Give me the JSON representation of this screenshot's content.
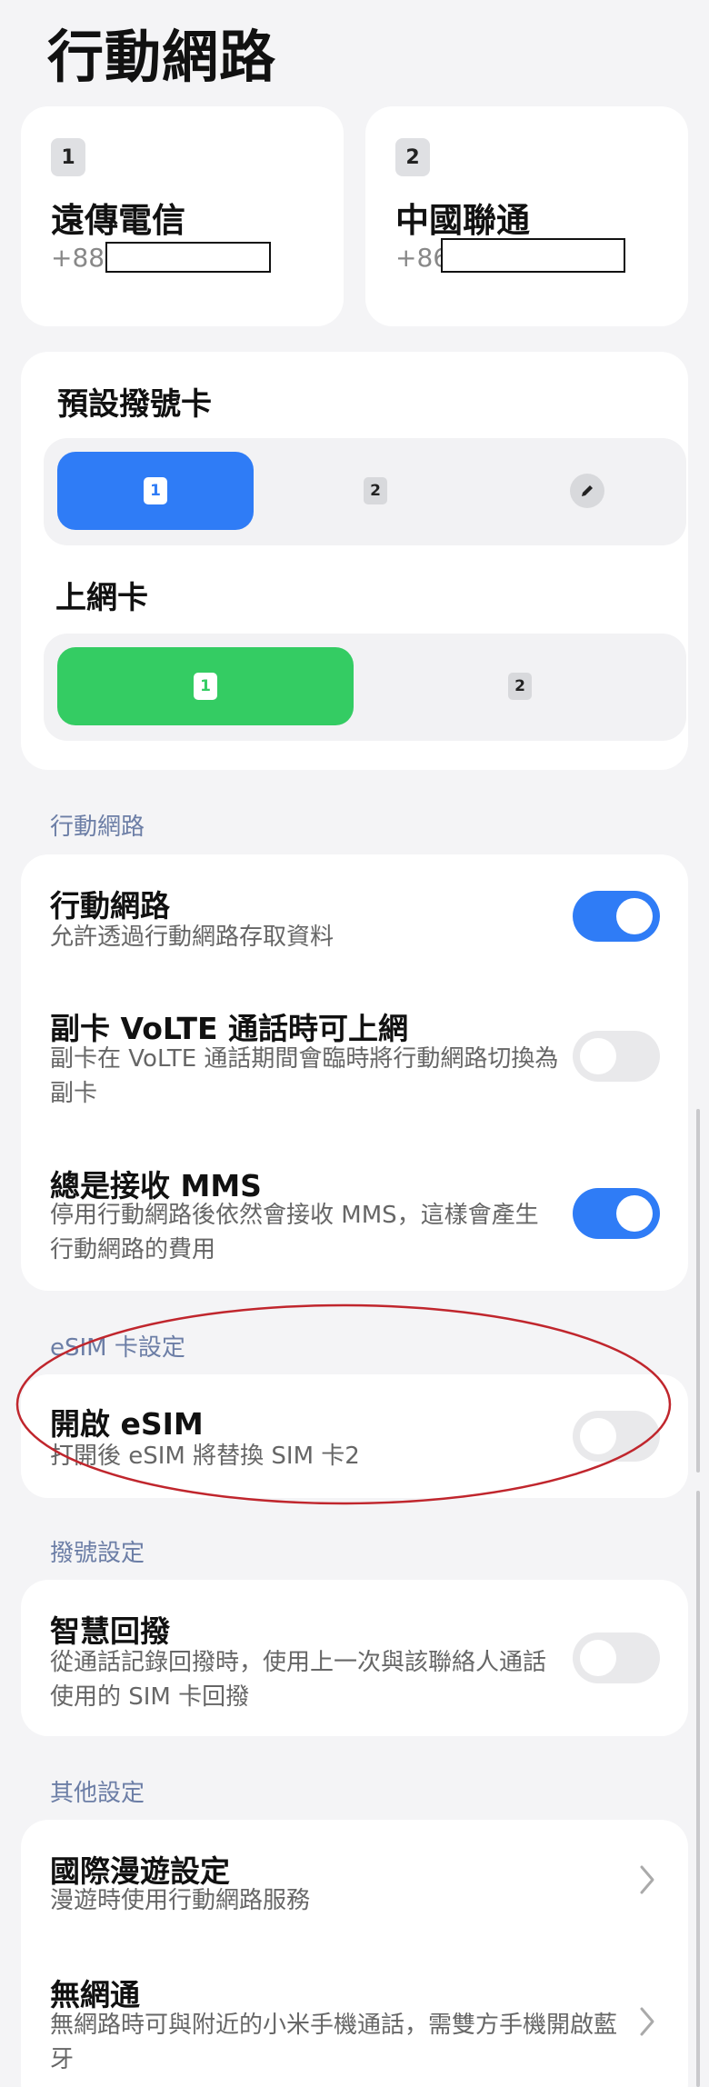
{
  "page": {
    "title": "行動網路"
  },
  "sim_cards": [
    {
      "slot": "1",
      "carrier": "遠傳電信",
      "number_prefix": "+886"
    },
    {
      "slot": "2",
      "carrier": "中國聯通",
      "number_prefix": "+86"
    }
  ],
  "default_dial": {
    "title": "預設撥號卡",
    "options": [
      "1",
      "2"
    ],
    "selected": "1",
    "edit_icon": "pencil-icon"
  },
  "data_card": {
    "title": "上網卡",
    "options": [
      "1",
      "2"
    ],
    "selected": "1"
  },
  "mobile_network_section": {
    "header": "行動網路",
    "rows": [
      {
        "title": "行動網路",
        "desc": "允許透過行動網路存取資料",
        "enabled": true
      },
      {
        "title": "副卡 VoLTE 通話時可上網",
        "desc": "副卡在 VoLTE 通話期間會臨時將行動網路切換為副卡",
        "enabled": false
      },
      {
        "title": "總是接收 MMS",
        "desc": "停用行動網路後依然會接收 MMS，這樣會產生行動網路的費用",
        "enabled": true
      }
    ]
  },
  "esim_section": {
    "header": "eSIM 卡設定",
    "row": {
      "title": "開啟 eSIM",
      "desc": "打開後 eSIM 將替換 SIM 卡2",
      "enabled": false
    }
  },
  "dial_section": {
    "header": "撥號設定",
    "row": {
      "title": "智慧回撥",
      "desc": "從通話記錄回撥時，使用上一次與該聯絡人通話使用的 SIM 卡回撥",
      "enabled": false
    }
  },
  "other_section": {
    "header": "其他設定",
    "rows": [
      {
        "title": "國際漫遊設定",
        "desc": "漫遊時使用行動網路服務"
      },
      {
        "title": "無網通",
        "desc": "無網路時可與附近的小米手機通話，需雙方手機開啟藍牙"
      }
    ]
  },
  "colors": {
    "accent_blue": "#2f7cf6",
    "accent_green": "#34cc63",
    "annotation_red": "#c0262d",
    "section_header": "#6c7ea6"
  }
}
